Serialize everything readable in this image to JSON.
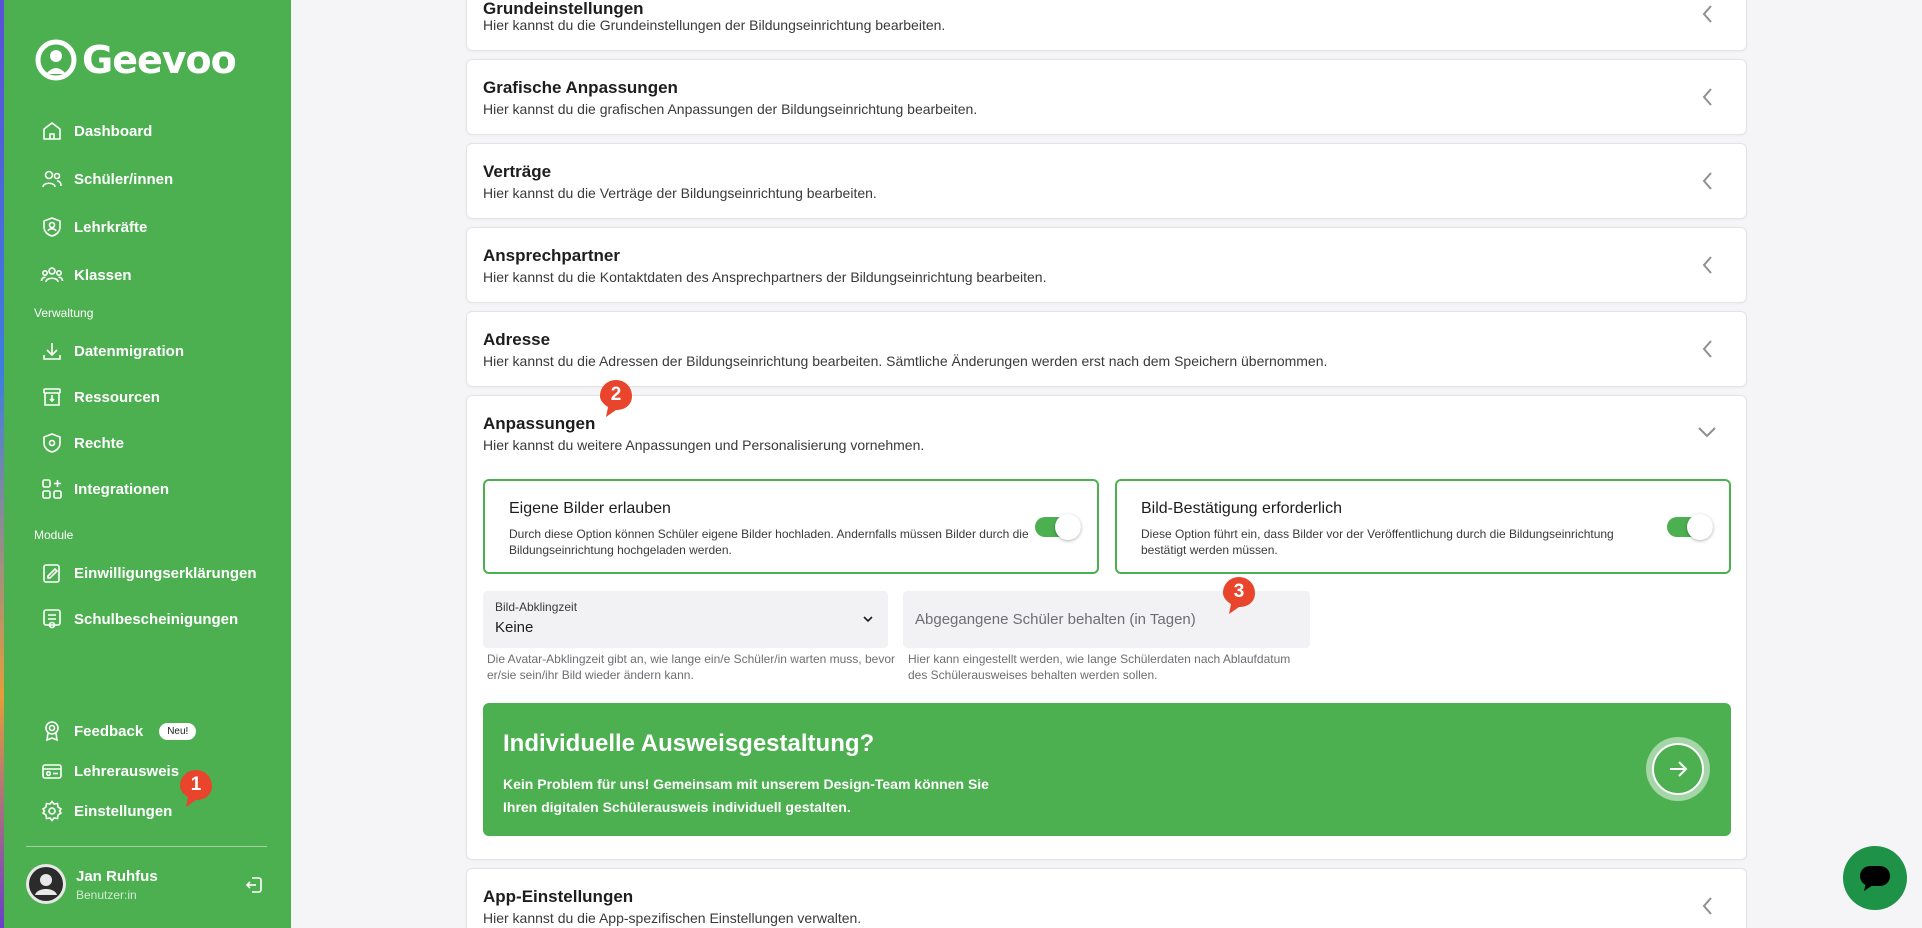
{
  "app": {
    "logo_text": "Geevoo"
  },
  "sidebar": {
    "items": [
      {
        "label": "Dashboard"
      },
      {
        "label": "Schüler/innen"
      },
      {
        "label": "Lehrkräfte"
      },
      {
        "label": "Klassen"
      }
    ],
    "section_verwaltung": "Verwaltung",
    "verwaltung_items": [
      {
        "label": "Datenmigration"
      },
      {
        "label": "Ressourcen"
      },
      {
        "label": "Rechte"
      },
      {
        "label": "Integrationen"
      }
    ],
    "section_module": "Module",
    "module_items": [
      {
        "label": "Einwilligungserklärungen"
      },
      {
        "label": "Schulbescheinigungen"
      }
    ],
    "bottom_items": [
      {
        "label": "Feedback",
        "badge": "Neu!"
      },
      {
        "label": "Lehrerausweis"
      },
      {
        "label": "Einstellungen"
      }
    ],
    "user": {
      "name": "Jan Ruhfus",
      "role": "Benutzer:in"
    }
  },
  "markers": [
    "1",
    "2",
    "3"
  ],
  "cards": [
    {
      "title": "Grundeinstellungen",
      "description": "Hier kannst du die Grundeinstellungen der Bildungseinrichtung bearbeiten."
    },
    {
      "title": "Grafische Anpassungen",
      "description": "Hier kannst du die grafischen Anpassungen der Bildungseinrichtung bearbeiten."
    },
    {
      "title": "Verträge",
      "description": "Hier kannst du die Verträge der Bildungseinrichtung bearbeiten."
    },
    {
      "title": "Ansprechpartner",
      "description": "Hier kannst du die Kontaktdaten des Ansprechpartners der Bildungseinrichtung bearbeiten."
    },
    {
      "title": "Adresse",
      "description": "Hier kannst du die Adressen der Bildungseinrichtung bearbeiten. Sämtliche Änderungen werden erst nach dem Speichern übernommen."
    }
  ],
  "anpassungen": {
    "title": "Anpassungen",
    "description": "Hier kannst du weitere Anpassungen und Personalisierung vornehmen.",
    "option_own_images": {
      "title": "Eigene Bilder erlauben",
      "description": "Durch diese Option können Schüler eigene Bilder hochladen. Andernfalls müssen Bilder durch die Bildungseinrichtung hochgeladen werden.",
      "enabled": true
    },
    "option_image_approval": {
      "title": "Bild-Bestätigung erforderlich",
      "description": "Diese Option führt ein, dass Bilder vor der Veröffentlichung durch die Bildungseinrichtung bestätigt werden müssen.",
      "enabled": true
    },
    "cooldown_select": {
      "label": "Bild-Abklingzeit",
      "value": "Keine",
      "helper": "Die Avatar-Abklingzeit gibt an, wie lange ein/e Schüler/in warten muss, bevor er/sie sein/ihr Bild wieder ändern kann."
    },
    "retention_input": {
      "placeholder": "Abgegangene Schüler behalten (in Tagen)",
      "helper": "Hier kann eingestellt werden, wie lange Schülerdaten nach Ablaufdatum des Schülerausweises behalten werden sollen."
    },
    "promo": {
      "title": "Individuelle Ausweisgestaltung?",
      "text": "Kein Problem für uns! Gemeinsam mit unserem Design-Team können Sie Ihren digitalen Schülerausweis individuell gestalten."
    }
  },
  "app_settings": {
    "title": "App-Einstellungen",
    "description": "Hier kannst du die App-spezifischen Einstellungen verwalten."
  },
  "colors": {
    "brand_green": "#4caf50",
    "marker_red": "#e8452c",
    "chat_green": "#1e9247"
  }
}
